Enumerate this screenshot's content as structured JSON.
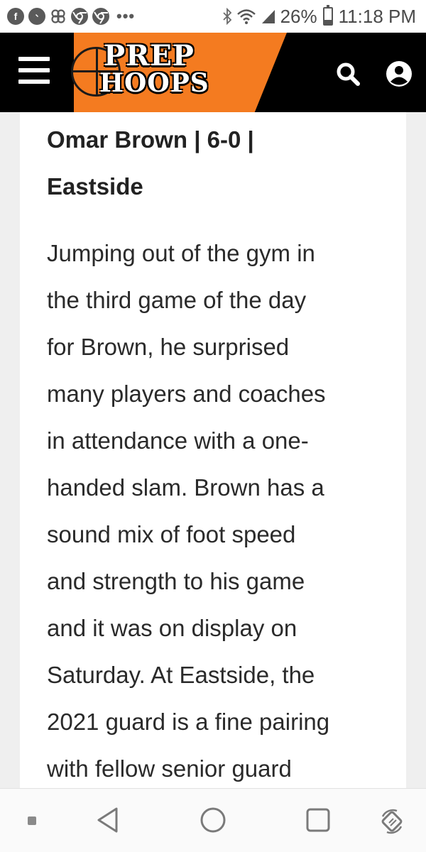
{
  "status_bar": {
    "notification_icons": [
      "facebook-icon",
      "messenger-icon",
      "pinwheel-icon",
      "chrome-icon",
      "chrome-icon"
    ],
    "more_dots": "•••",
    "battery_percent": "26%",
    "battery_level": 0.26,
    "time": "11:18 PM"
  },
  "header": {
    "logo_line1": "PREP",
    "logo_line2": "HOOPS",
    "accent_color": "#f47b20"
  },
  "article": {
    "heading_lines": [
      "Omar Brown | 6-0 |",
      "Eastside"
    ],
    "body_lines": [
      "Jumping out of the gym in",
      "the third game of the day",
      "for Brown, he surprised",
      "many players and coaches",
      "in attendance with a one-",
      "handed slam. Brown has a",
      "sound mix of foot speed",
      "and strength to his game",
      "and it was on display on",
      "Saturday. At Eastside, the",
      "2021 guard is a fine pairing",
      "with fellow senior guard"
    ]
  },
  "nav_bar": {
    "buttons": [
      "menu-dot-icon",
      "back-icon",
      "home-icon",
      "recents-icon",
      "rotate-icon"
    ]
  }
}
